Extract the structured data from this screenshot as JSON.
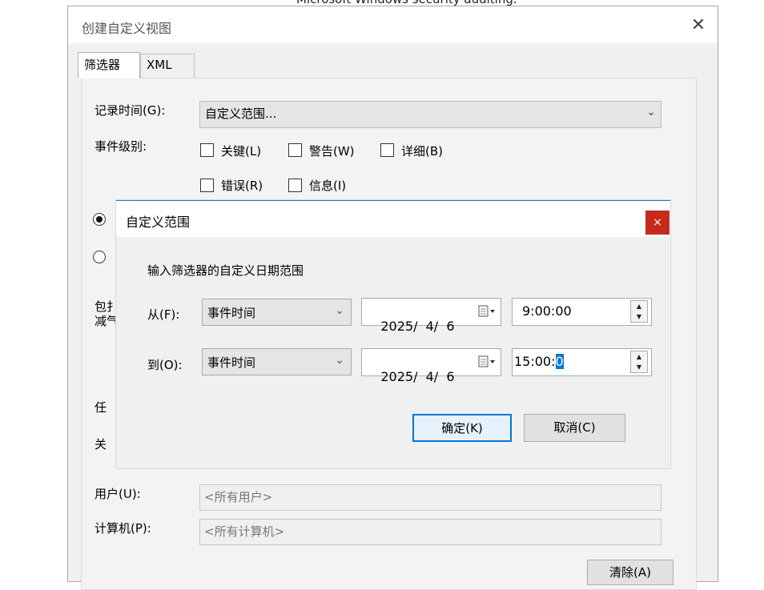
{
  "background": {
    "text": "Microsoft Windows security auditing."
  },
  "outer": {
    "title": "创建自定义视图",
    "close_glyph": "✕",
    "tabs": [
      {
        "label": "筛选器"
      },
      {
        "label": "XML"
      }
    ],
    "logged_label": "记录时间(G):",
    "logged_value": "自定义范围...",
    "level_label": "事件级别:",
    "levels": [
      {
        "label": "关键(L)",
        "checked": false
      },
      {
        "label": "警告(W)",
        "checked": false
      },
      {
        "label": "详细(B)",
        "checked": false
      },
      {
        "label": "错误(R)",
        "checked": false
      },
      {
        "label": "信息(I)",
        "checked": false
      }
    ],
    "radio1_partial": "",
    "radio2_partial": "",
    "include_label_partial": "包扌",
    "include_label_partial2": "减气",
    "task_label_partial": "任 ",
    "keyword_label_partial": "关 ",
    "user_label": "用户(U):",
    "user_placeholder": "<所有用户>",
    "computer_label": "计算机(P):",
    "computer_placeholder": "<所有计算机>",
    "clear_button": "清除(A)"
  },
  "inner": {
    "title": "自定义范围",
    "close_glyph": "×",
    "instruction": "输入筛选器的自定义日期范围",
    "from_label": "从(F):",
    "from_type": "事件时间",
    "from_date": "2025/  4/  6",
    "from_time": "9:00:00",
    "to_label": "到(O):",
    "to_type": "事件时间",
    "to_date": "2025/  4/  6",
    "to_time_prefix": "15:00:",
    "to_time_selected": "0",
    "ok_button": "确定(K)",
    "cancel_button": "取消(C)"
  }
}
